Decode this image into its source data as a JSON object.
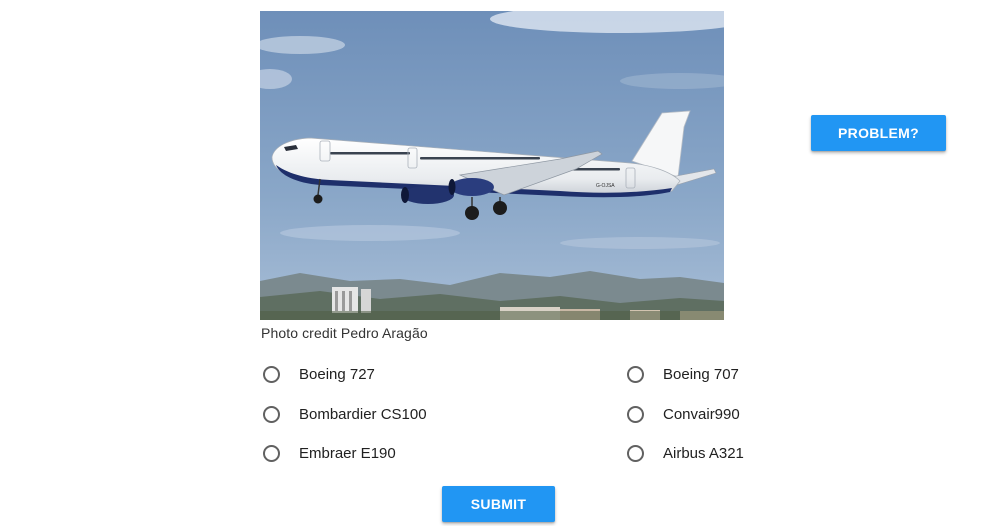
{
  "photo": {
    "subject": "airliner-in-flight",
    "credit": "Photo credit Pedro Aragão"
  },
  "options": {
    "left": [
      {
        "label": "Boeing 727",
        "selected": false
      },
      {
        "label": "Bombardier CS100",
        "selected": false
      },
      {
        "label": "Embraer E190",
        "selected": false
      }
    ],
    "right": [
      {
        "label": "Boeing 707",
        "selected": false
      },
      {
        "label": "Convair990",
        "selected": false
      },
      {
        "label": "Airbus A321",
        "selected": false
      }
    ]
  },
  "buttons": {
    "problem_label": "PROBLEM?",
    "submit_label": "SUBMIT"
  },
  "colors": {
    "accent": "#2196f3",
    "radio_border": "#616161"
  }
}
